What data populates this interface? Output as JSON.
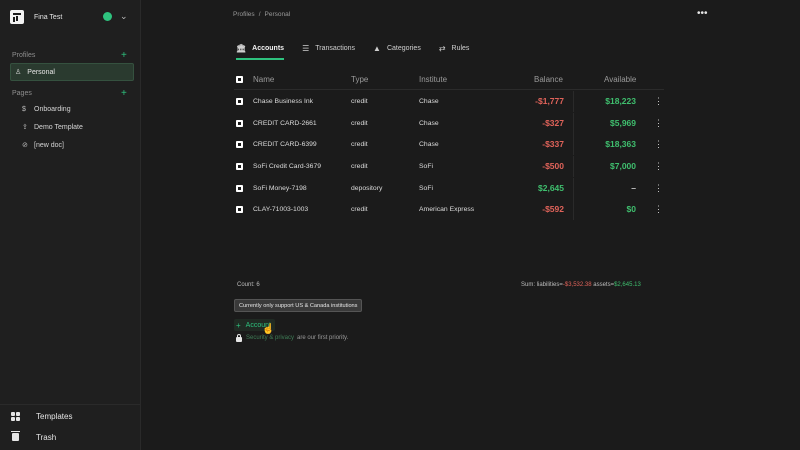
{
  "workspace": {
    "name": "Fina Test",
    "status_color": "#2ec27e"
  },
  "sidebar": {
    "profiles_title": "Profiles",
    "profiles": [
      {
        "label": "Personal",
        "icon": "person-icon"
      }
    ],
    "pages_title": "Pages",
    "pages": [
      {
        "label": "Onboarding",
        "icon": "dollar-icon"
      },
      {
        "label": "Demo Template",
        "icon": "upload-icon"
      },
      {
        "label": "[new doc]",
        "icon": "no-icon"
      }
    ],
    "bottom": [
      {
        "label": "Templates",
        "icon": "grid-icon"
      },
      {
        "label": "Trash",
        "icon": "trash-icon"
      }
    ]
  },
  "breadcrumb": {
    "root": "Profiles",
    "sep": "/",
    "current": "Personal"
  },
  "tabs": [
    {
      "label": "Accounts",
      "icon": "bank-icon",
      "active": true
    },
    {
      "label": "Transactions",
      "icon": "list-icon",
      "active": false
    },
    {
      "label": "Categories",
      "icon": "shapes-icon",
      "active": false
    },
    {
      "label": "Rules",
      "icon": "rules-icon",
      "active": false
    }
  ],
  "table": {
    "columns": [
      "Name",
      "Type",
      "Institute",
      "Balance",
      "Available"
    ],
    "rows": [
      {
        "name": "Chase Business Ink",
        "type": "credit",
        "institute": "Chase",
        "balance": "-$1,777",
        "available": "$18,223"
      },
      {
        "name": "CREDIT CARD-2661",
        "type": "credit",
        "institute": "Chase",
        "balance": "-$327",
        "available": "$5,969"
      },
      {
        "name": "CREDIT CARD-6399",
        "type": "credit",
        "institute": "Chase",
        "balance": "-$337",
        "available": "$18,363"
      },
      {
        "name": "SoFi Credit Card-3679",
        "type": "credit",
        "institute": "SoFi",
        "balance": "-$500",
        "available": "$7,000"
      },
      {
        "name": "SoFi Money-7198",
        "type": "depository",
        "institute": "SoFi",
        "balance": "$2,645",
        "available": "–"
      },
      {
        "name": "CLAY-71003-1003",
        "type": "credit",
        "institute": "American Express",
        "balance": "-$592",
        "available": "$0"
      }
    ]
  },
  "footer": {
    "count": "Count: 6",
    "sum_prefix": "Sum: liabilities=",
    "liabilities": "-$3,532.38",
    "assets_prefix": "assets=",
    "assets": "$2,645.13",
    "tooltip": "Currently only support US & Canada institutions",
    "add_account": "Account",
    "security_link": "Security & privacy",
    "security_text": "are our first priority."
  },
  "colors": {
    "accent": "#2ec27e",
    "negative": "#e0635a",
    "positive": "#3fbf6e"
  }
}
